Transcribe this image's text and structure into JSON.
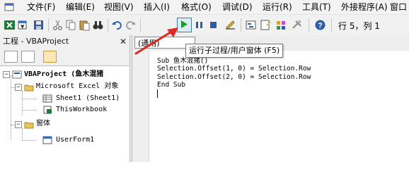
{
  "menubar": {
    "items": [
      "文件(F)",
      "编辑(E)",
      "视图(V)",
      "插入(I)",
      "格式(O)",
      "调试(D)",
      "运行(R)",
      "工具(T)",
      "外接程序(A)",
      "窗口"
    ]
  },
  "toolbar": {
    "icons": [
      "excel-icon",
      "insert-userform-icon",
      "save-icon",
      "cut-icon",
      "copy-icon",
      "paste-icon",
      "find-icon",
      "undo-icon",
      "redo-icon",
      "run-icon",
      "break-icon",
      "reset-icon",
      "design-mode-icon",
      "project-explorer-icon",
      "properties-icon",
      "object-browser-icon",
      "toolbox-icon",
      "help-icon"
    ],
    "position": "行 5，列 1",
    "run_tooltip": "运行子过程/用户窗体 (F5)"
  },
  "project": {
    "title": "工程 - VBAProject",
    "tree": [
      {
        "label": "VBAProject (鱼木混猪",
        "level": 0
      },
      {
        "label": "Microsoft Excel 对象",
        "level": 1
      },
      {
        "label": "Sheet1 (Sheet1)",
        "level": 2
      },
      {
        "label": "ThisWorkbook",
        "level": 2
      },
      {
        "label": "窗体",
        "level": 1
      },
      {
        "label": "UserForm1",
        "level": 2
      }
    ]
  },
  "code": {
    "object_dropdown": "(通用)",
    "lines": [
      "Sub 鱼木混猪()",
      "Selection.Offset(1, 0) = Selection.Row",
      "Selection.Offset(2, 0) = Selection.Row",
      "End Sub"
    ]
  },
  "colors": {
    "accent": "#3c7fb1",
    "annotation": "#e0281e",
    "run_green": "#1e9a2c"
  }
}
